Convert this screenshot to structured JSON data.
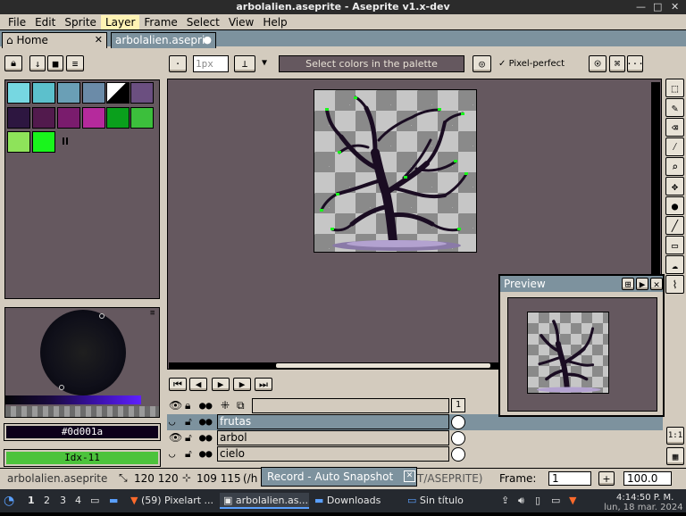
{
  "window": {
    "title": "arbolalien.aseprite - Aseprite v1.x-dev",
    "minimize": "—",
    "maximize": "□",
    "close": "✕"
  },
  "menu": [
    "File",
    "Edit",
    "Sprite",
    "Layer",
    "Frame",
    "Select",
    "View",
    "Help"
  ],
  "tabs": [
    {
      "label": "Home",
      "close": "✕"
    },
    {
      "label": "arbolalien.asepri",
      "close": "●"
    }
  ],
  "context_bar": {
    "brush_size": "1px",
    "hint": "Select colors in the palette",
    "pixel_perfect": "Pixel-perfect",
    "more": "···"
  },
  "palette": {
    "colors": [
      "#76d7e1",
      "#5cc0cc",
      "#6a9fb6",
      "#6b8ba8",
      "#000000",
      "#6b4f80",
      "#2d1640",
      "#521a4d",
      "#7a1c6d",
      "#b52a9c",
      "#0aa01c",
      "#3cbf3c",
      "#8ee35a",
      "#19f51c"
    ],
    "fg_color": "#0d001a",
    "fg_hex": "#0d001a",
    "index_label": "Idx-11"
  },
  "timeline": {
    "frame_number": "1",
    "layers": [
      {
        "name": "",
        "visible": true,
        "selected": false
      },
      {
        "name": "frutas",
        "visible": false,
        "selected": true
      },
      {
        "name": "arbol",
        "visible": true,
        "selected": false
      },
      {
        "name": "cielo",
        "visible": false,
        "selected": false
      }
    ]
  },
  "preview": {
    "title": "Preview"
  },
  "status": {
    "filename": "arbolalien.aseprite",
    "size": "120 120",
    "position": "109 115",
    "path_left": "(/h",
    "path_right": "T/ASEPRITE)",
    "frame_label": "Frame:",
    "frame_value": "1",
    "zoom": "100.0",
    "one_to_one": "1:1"
  },
  "record_popup": {
    "label": "Record - Auto Snapshot"
  },
  "taskbar": {
    "workspaces": [
      "1",
      "2",
      "3",
      "4"
    ],
    "tasks": [
      {
        "label": "(59) Pixelart ..."
      },
      {
        "label": "arbolalien.as..."
      },
      {
        "label": "Downloads"
      },
      {
        "label": "Sin título"
      }
    ],
    "time": "4:14:50 P. M.",
    "date": "lun, 18 mar. 2024"
  }
}
